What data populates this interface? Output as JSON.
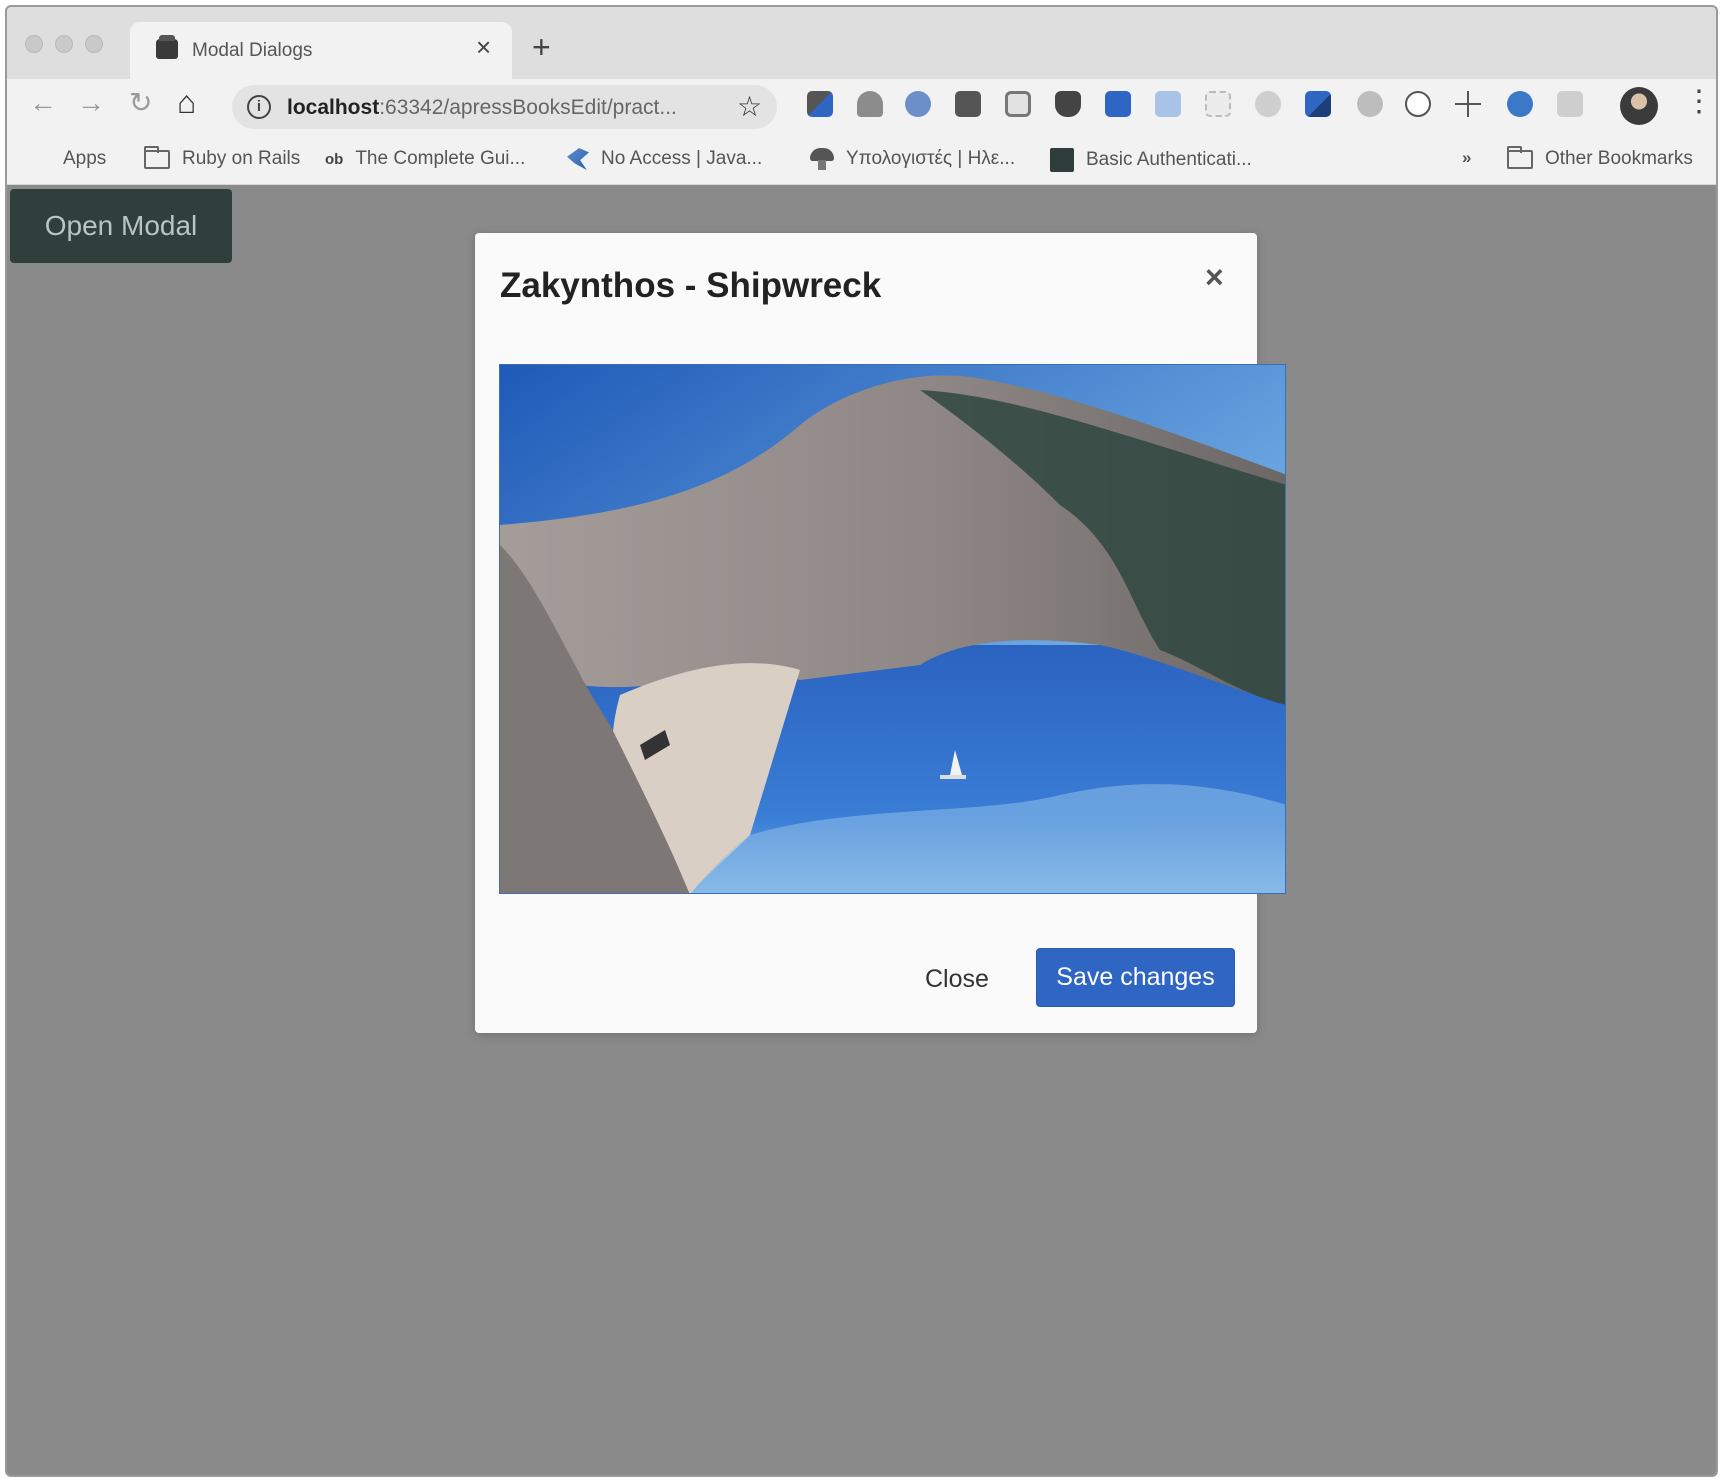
{
  "browser": {
    "tab": {
      "title": "Modal Dialogs",
      "close_glyph": "×"
    },
    "new_tab_glyph": "+",
    "nav": {
      "back_glyph": "←",
      "forward_glyph": "→",
      "reload_glyph": "↻",
      "home_glyph": "⌂"
    },
    "omnibox": {
      "host": "localhost",
      "rest": ":63342/apressBooksEdit/pract..."
    },
    "bookmark_star_glyph": "☆",
    "menu_glyph": "⋮",
    "bookmarks": {
      "apps": "Apps",
      "items": [
        "Ruby on Rails",
        "The Complete Gui...",
        "No Access | Java...",
        "Υπολογιστές | Ηλε...",
        "Basic Authenticati..."
      ],
      "ob_mark": "ob",
      "overflow_glyph": "»",
      "other": "Other Bookmarks"
    }
  },
  "page": {
    "open_modal_label": "Open Modal",
    "modal": {
      "title": "Zakynthos - Shipwreck",
      "close_glyph": "×",
      "close_label": "Close",
      "save_label": "Save changes"
    }
  },
  "colors": {
    "overlay": "#8a8a8a",
    "open_modal_bg": "#2f3f3c",
    "primary": "#2f66c4",
    "sea": "#2f6fc8"
  }
}
